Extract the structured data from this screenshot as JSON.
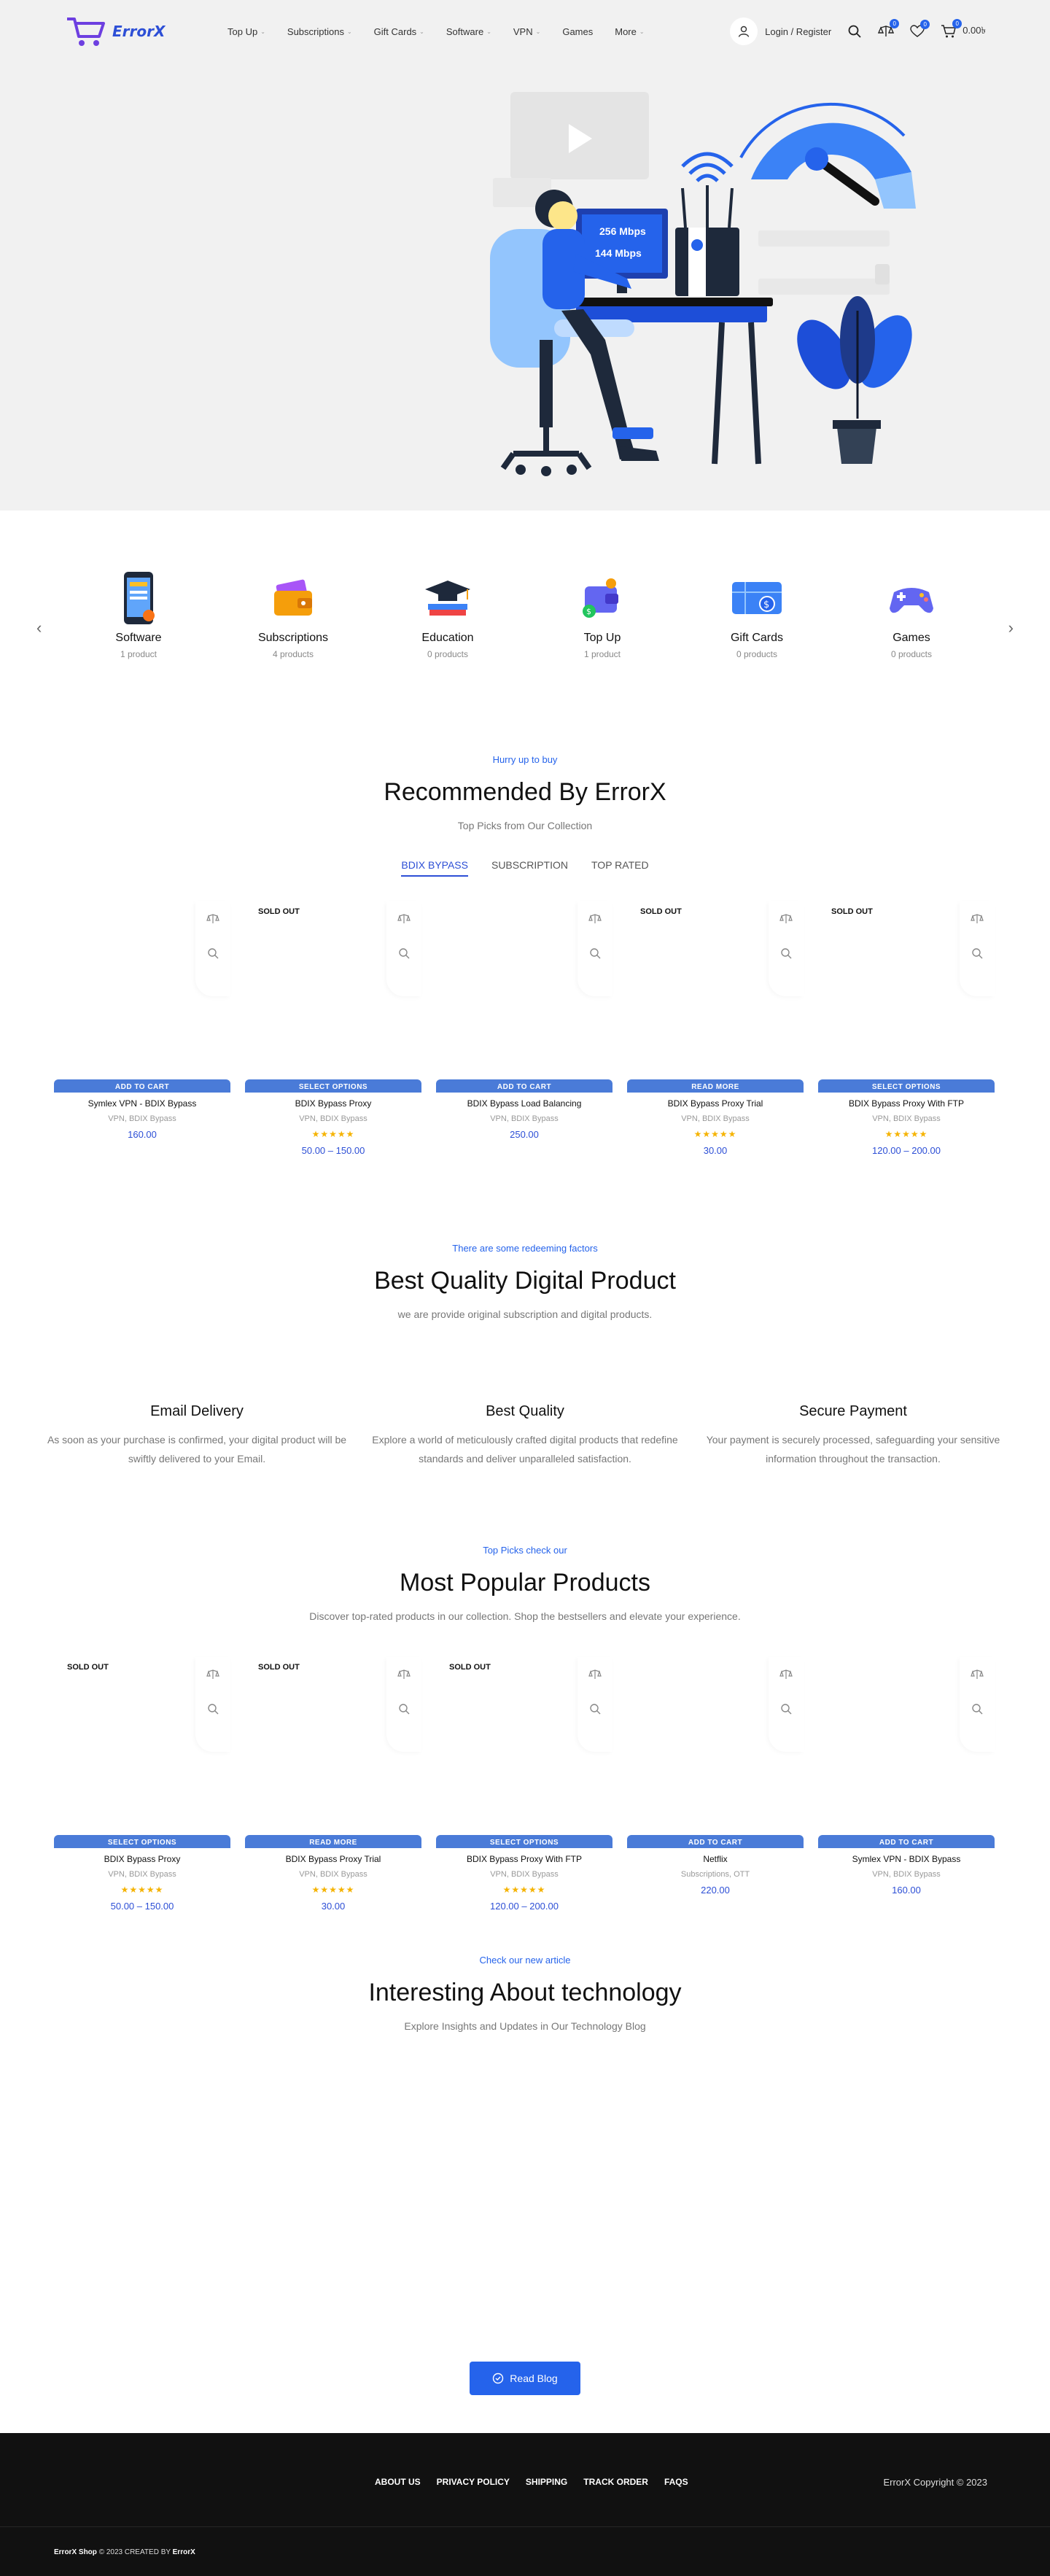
{
  "header": {
    "logo_text": "ErrorX",
    "nav": [
      {
        "label": "Top Up",
        "has_dropdown": true
      },
      {
        "label": "Subscriptions",
        "has_dropdown": true
      },
      {
        "label": "Gift Cards",
        "has_dropdown": true
      },
      {
        "label": "Software",
        "has_dropdown": true
      },
      {
        "label": "VPN",
        "has_dropdown": true
      },
      {
        "label": "Games",
        "has_dropdown": false
      },
      {
        "label": "More",
        "has_dropdown": true
      }
    ],
    "login_label": "Login / Register",
    "compare_count": "0",
    "wishlist_count": "0",
    "cart_count": "0",
    "cart_total": "0.00৳"
  },
  "hero": {
    "speed_1": "256 Mbps",
    "speed_2": "144 Mbps"
  },
  "categories": [
    {
      "name": "Software",
      "count": "1 product",
      "icon": "phone-icon"
    },
    {
      "name": "Subscriptions",
      "count": "4 products",
      "icon": "wallet-icon"
    },
    {
      "name": "Education",
      "count": "0 products",
      "icon": "graduation-icon"
    },
    {
      "name": "Top Up",
      "count": "1 product",
      "icon": "topup-wallet-icon"
    },
    {
      "name": "Gift Cards",
      "count": "0 products",
      "icon": "gift-card-icon"
    },
    {
      "name": "Games",
      "count": "0 products",
      "icon": "gamepad-icon"
    }
  ],
  "recommended": {
    "eyebrow": "Hurry up to buy",
    "title": "Recommended By ErrorX",
    "subtitle": "Top Picks from Our Collection",
    "tabs": [
      "BDIX BYPASS",
      "SUBSCRIPTION",
      "TOP RATED"
    ],
    "products": [
      {
        "name": "Symlex VPN - BDIX Bypass",
        "meta": "VPN, BDIX Bypass",
        "price": "160.00",
        "button": "ADD TO CART",
        "sold_out": "",
        "stars": ""
      },
      {
        "name": "BDIX Bypass Proxy",
        "meta": "VPN, BDIX Bypass",
        "price": "50.00  – 150.00",
        "button": "SELECT OPTIONS",
        "sold_out": "SOLD OUT",
        "stars": "★★★★★"
      },
      {
        "name": "BDIX Bypass Load Balancing",
        "meta": "VPN, BDIX Bypass",
        "price": "250.00",
        "button": "ADD TO CART",
        "sold_out": "",
        "stars": ""
      },
      {
        "name": "BDIX Bypass Proxy Trial",
        "meta": "VPN, BDIX Bypass",
        "price": "30.00",
        "button": "READ MORE",
        "sold_out": "SOLD OUT",
        "stars": "★★★★★"
      },
      {
        "name": "BDIX Bypass Proxy With FTP",
        "meta": "VPN, BDIX Bypass",
        "price": "120.00  – 200.00",
        "button": "SELECT OPTIONS",
        "sold_out": "SOLD OUT",
        "stars": "★★★★★"
      }
    ]
  },
  "quality": {
    "eyebrow": "There are some redeeming factors",
    "title": "Best Quality Digital Product",
    "subtitle": "we are provide original subscription and digital products.",
    "features": [
      {
        "title": "Email Delivery",
        "desc": "As soon as your purchase is confirmed, your digital product will be swiftly delivered to your Email."
      },
      {
        "title": "Best Quality",
        "desc": "Explore a world of meticulously crafted digital products that redefine standards and deliver unparalleled satisfaction."
      },
      {
        "title": "Secure Payment",
        "desc": "Your payment is securely processed, safeguarding your sensitive information throughout the transaction."
      }
    ]
  },
  "popular": {
    "eyebrow": "Top Picks check our",
    "title": "Most Popular Products",
    "subtitle": "Discover top-rated products in our collection. Shop the bestsellers and elevate your experience.",
    "products": [
      {
        "name": "BDIX Bypass Proxy",
        "meta": "VPN, BDIX Bypass",
        "price": "50.00  – 150.00",
        "button": "SELECT OPTIONS",
        "sold_out": "SOLD OUT",
        "stars": "★★★★★"
      },
      {
        "name": "BDIX Bypass Proxy Trial",
        "meta": "VPN, BDIX Bypass",
        "price": "30.00",
        "button": "READ MORE",
        "sold_out": "SOLD OUT",
        "stars": "★★★★★"
      },
      {
        "name": "BDIX Bypass Proxy With FTP",
        "meta": "VPN, BDIX Bypass",
        "price": "120.00  – 200.00",
        "button": "SELECT OPTIONS",
        "sold_out": "SOLD OUT",
        "stars": "★★★★★"
      },
      {
        "name": "Netflix",
        "meta": "Subscriptions, OTT",
        "price": "220.00",
        "button": "ADD TO CART",
        "sold_out": "",
        "stars": ""
      },
      {
        "name": "Symlex VPN - BDIX Bypass",
        "meta": "VPN, BDIX Bypass",
        "price": "160.00",
        "button": "ADD TO CART",
        "sold_out": "",
        "stars": ""
      }
    ]
  },
  "blog": {
    "eyebrow": "Check our new article",
    "title": "Interesting About technology",
    "subtitle": "Explore Insights and Updates in Our Technology Blog",
    "button": "Read Blog"
  },
  "footer": {
    "links": [
      "ABOUT US",
      "PRIVACY POLICY",
      "SHIPPING",
      "TRACK ORDER",
      "FAQS"
    ],
    "copyright": "ErrorX Copyright © 2023",
    "bottom_shop": "ErrorX Shop",
    "bottom_created": "2023 CREATED BY",
    "bottom_brand": "ErrorX"
  },
  "colors": {
    "accent": "#2563eb",
    "button": "#4a7bd8",
    "star": "#f5b301",
    "footer_bg": "#111111"
  }
}
